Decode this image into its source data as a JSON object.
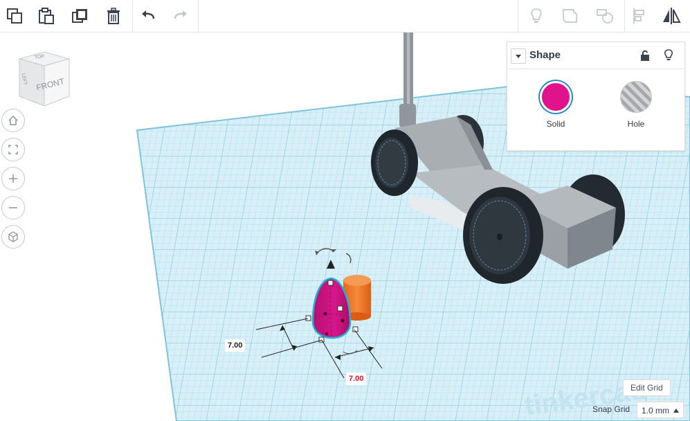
{
  "toolbar": {
    "copy": "copy-icon",
    "paste": "paste-icon",
    "duplicate": "duplicate-icon",
    "delete": "trash-icon",
    "undo": "undo-arrow-icon",
    "redo": "redo-arrow-icon",
    "right_tools": [
      "lightbulb-icon",
      "group-icon",
      "ungroup-icon",
      "align-icon",
      "mirror-icon"
    ]
  },
  "view_cube": {
    "top_label": "TOP",
    "front_label": "FRONT",
    "left_label": "LEFT"
  },
  "view_controls": [
    "home-view-icon",
    "fit-view-icon",
    "zoom-in-icon",
    "zoom-out-icon",
    "perspective-icon"
  ],
  "shape_panel": {
    "title": "Shape",
    "solid_label": "Solid",
    "hole_label": "Hole",
    "solid_color": "#e0138c",
    "hole_color": "#b8b8b8"
  },
  "dimensions": {
    "height_value": "7.00",
    "width_value": "7.00"
  },
  "bottom": {
    "edit_grid_label": "Edit Grid",
    "snap_grid_label": "Snap Grid",
    "snap_value": "1.0 mm"
  },
  "colors": {
    "grid": "#a6dbea",
    "selected_shape": "#d0157f",
    "cylinder": "#f47f2a",
    "car_body": "#9ea3a8",
    "wheels": "#2a3138",
    "selection_outline": "#1fb0d6"
  }
}
